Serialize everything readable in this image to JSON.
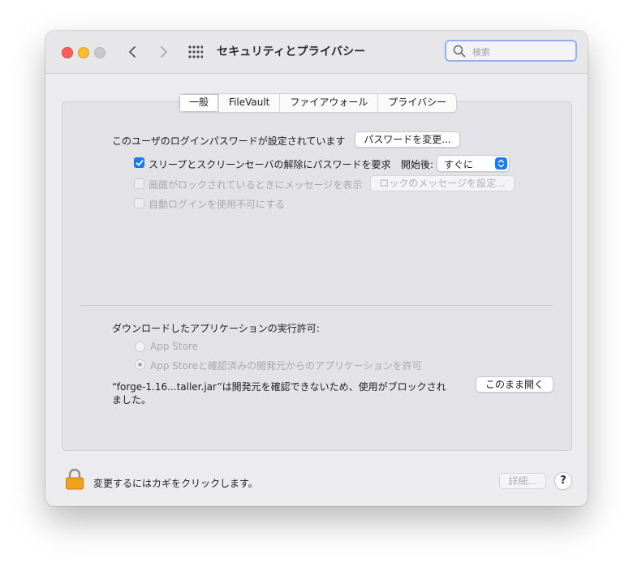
{
  "window": {
    "title": "セキュリティとプライバシー",
    "search": {
      "placeholder": "検索",
      "value": ""
    }
  },
  "tabs": [
    {
      "label": "一般",
      "active": true
    },
    {
      "label": "FileVault",
      "active": false
    },
    {
      "label": "ファイアウォール",
      "active": false
    },
    {
      "label": "プライバシー",
      "active": false
    }
  ],
  "general": {
    "password_text": "このユーザのログインパスワードが設定されています",
    "change_password_button": "パスワードを変更...",
    "require_password": {
      "label": "スリープとスクリーンセーバの解除にパスワードを要求",
      "checked": true
    },
    "start_after_label": "開始後:",
    "start_after_value": "すぐに",
    "show_message": {
      "label": "画面がロックされているときにメッセージを表示",
      "checked": false,
      "enabled": false
    },
    "set_lock_message_button": "ロックのメッセージを設定...",
    "disable_auto_login": {
      "label": "自動ログインを使用不可にする",
      "checked": false,
      "enabled": false
    }
  },
  "downloads": {
    "heading": "ダウンロードしたアプリケーションの実行許可:",
    "option_app_store": "App Store",
    "option_identified": "App Storeと確認済みの開発元からのアプリケーションを許可",
    "blocked_line1": "“forge-1.16...taller.jar”は開発元を確認できないため、使用がブロックされ",
    "blocked_line2": "ました。",
    "open_anyway_button": "このまま開く"
  },
  "footer": {
    "lock_text": "変更するにはカギをクリックします。",
    "advanced_button": "詳細...",
    "help_label": "?"
  },
  "colors": {
    "accent": "#1a7cf5",
    "close": "#fe5f57",
    "minimize": "#febc2e",
    "lock": "#f0a21e"
  }
}
